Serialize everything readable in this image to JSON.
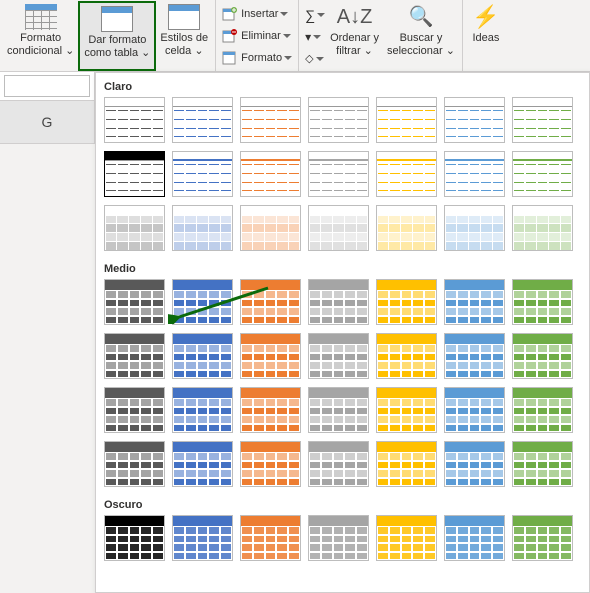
{
  "ribbon": {
    "formato_condicional": "Formato\ncondicional ⌄",
    "dar_formato": "Dar formato\ncomo tabla ⌄",
    "estilos": "Estilos de\ncelda ⌄",
    "insertar": "Insertar",
    "eliminar": "Eliminar",
    "formato": "Formato",
    "ordenar": "Ordenar y\nfiltrar ⌄",
    "buscar": "Buscar y\nseleccionar ⌄",
    "ideas": "Ideas"
  },
  "sheet": {
    "col_letter": "G"
  },
  "gallery": {
    "sections": {
      "claro": "Claro",
      "medio": "Medio",
      "oscuro": "Oscuro"
    },
    "palette": [
      "#595959",
      "#4472c4",
      "#ed7d31",
      "#a5a5a5",
      "#ffc000",
      "#5b9bd5",
      "#70ad47"
    ],
    "dark_palette": [
      "#000000",
      "#4472c4",
      "#ed7d31",
      "#a5a5a5",
      "#ffc000",
      "#5b9bd5",
      "#70ad47"
    ]
  }
}
